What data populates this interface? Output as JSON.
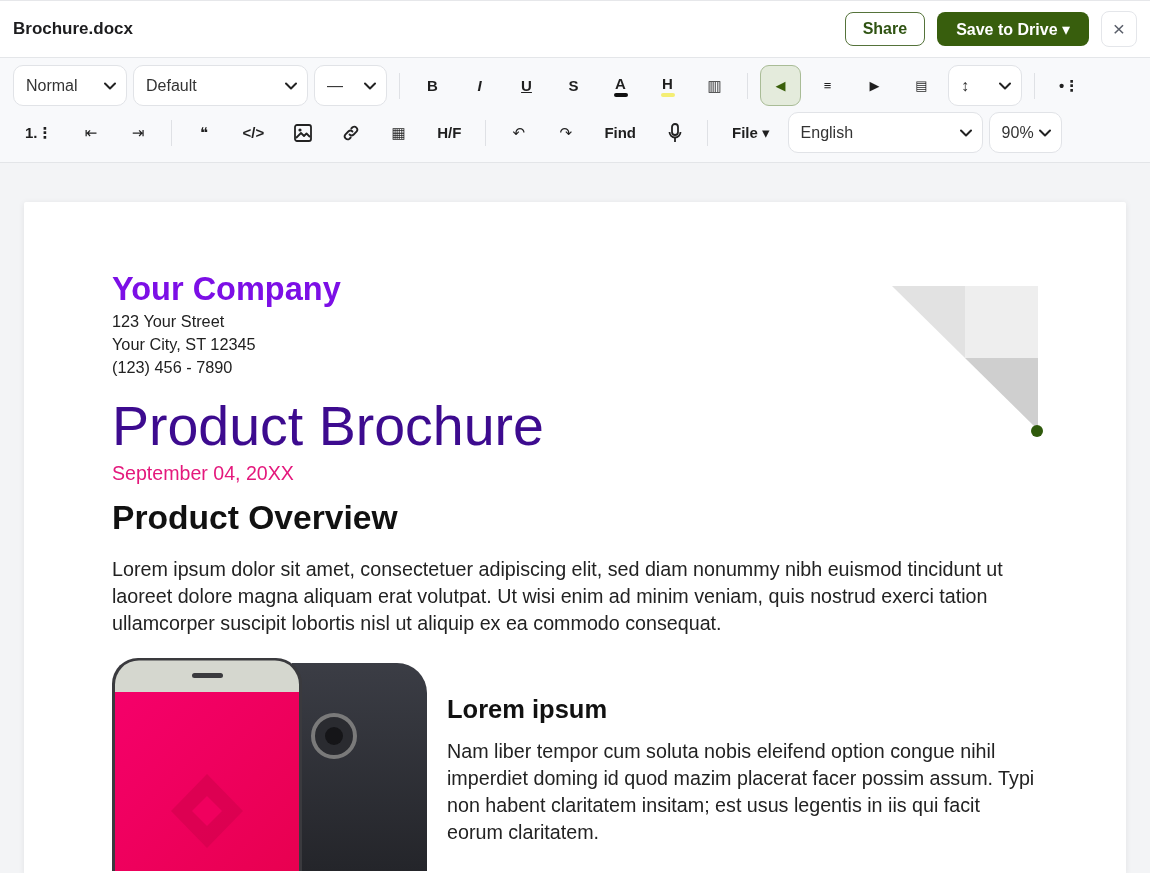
{
  "header": {
    "title": "Brochure.docx",
    "buttons": [
      {
        "kind": "outline",
        "label": "Share"
      },
      {
        "kind": "primary",
        "label": "Save to Drive ▾"
      },
      {
        "kind": "close",
        "label": "×"
      }
    ]
  },
  "toolbar": {
    "rows": [
      {
        "items": [
          {
            "kind": "select",
            "value": "Normal"
          },
          {
            "kind": "select",
            "value": "Default"
          },
          {
            "kind": "select",
            "value": "—"
          },
          {
            "kind": "sep"
          },
          {
            "kind": "button",
            "label": "B"
          },
          {
            "kind": "button",
            "label": "I"
          },
          {
            "kind": "button",
            "label": "U"
          },
          {
            "kind": "button",
            "label": "S"
          },
          {
            "kind": "button",
            "label": "A",
            "color": "#111111"
          },
          {
            "kind": "button",
            "label": "H",
            "color": "#f4ee74"
          },
          {
            "kind": "button",
            "label": "▥"
          },
          {
            "kind": "sep"
          },
          {
            "kind": "align",
            "label": "◀",
            "selected": true
          },
          {
            "kind": "align",
            "label": "≡",
            "selected": false
          },
          {
            "kind": "align",
            "label": "▶",
            "selected": false
          },
          {
            "kind": "align",
            "label": "▤",
            "selected": false
          },
          {
            "kind": "select",
            "value": "↕"
          },
          {
            "kind": "sep"
          },
          {
            "kind": "button",
            "label": "•⋮"
          }
        ]
      },
      {
        "items": [
          {
            "kind": "button",
            "label": "1.⋮"
          },
          {
            "kind": "button",
            "label": "⇤"
          },
          {
            "kind": "button",
            "label": "⇥"
          },
          {
            "kind": "sep"
          },
          {
            "kind": "button",
            "label": "❝"
          },
          {
            "kind": "button",
            "label": "</>"
          },
          {
            "kind": "image"
          },
          {
            "kind": "link"
          },
          {
            "kind": "button",
            "label": "▦"
          },
          {
            "kind": "button",
            "label": "H/F"
          },
          {
            "kind": "sep"
          },
          {
            "kind": "button",
            "label": "↶"
          },
          {
            "kind": "button",
            "label": "↷"
          },
          {
            "kind": "button",
            "label": "Find"
          },
          {
            "kind": "mic"
          },
          {
            "kind": "sep"
          },
          {
            "kind": "button",
            "label": "File ▾"
          },
          {
            "kind": "select",
            "value": "English"
          },
          {
            "kind": "select",
            "value": "90%"
          }
        ]
      }
    ]
  },
  "document": {
    "company": "Your Company",
    "address": [
      "123 Your Street",
      "Your City, ST 12345",
      "(123) 456 - 7890"
    ],
    "title": "Product Brochure",
    "date": "September 04, 20XX",
    "heading": "Product Overview",
    "intro": "Lorem ipsum dolor sit amet, consectetuer adipiscing elit, sed diam nonummy nibh euismod tincidunt ut laoreet dolore magna aliquam erat volutpat. Ut wisi enim ad minim veniam, quis nostrud exerci tation ullamcorper suscipit lobortis nisl ut aliquip ex ea commodo consequat.",
    "feature": {
      "heading": "Lorem ipsum",
      "text": "Nam liber tempor cum soluta nobis eleifend option congue nihil imperdiet doming id quod mazim placerat facer possim assum. Typi non habent claritatem insitam; est usus legentis in iis qui facit eorum claritatem."
    }
  }
}
